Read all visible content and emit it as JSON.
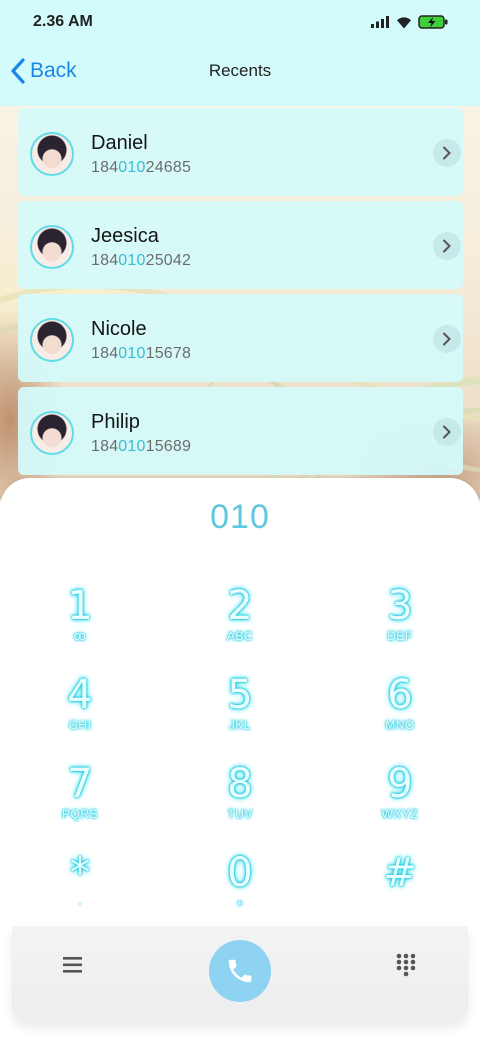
{
  "status_bar": {
    "time": "2.36 AM",
    "icons": [
      "signal-icon",
      "wifi-icon",
      "battery-charging-icon"
    ]
  },
  "header": {
    "back_label": "Back",
    "title": "Recents"
  },
  "contacts": [
    {
      "name": "Daniel",
      "number_pre": "184",
      "number_match": "010",
      "number_post": "24685"
    },
    {
      "name": "Jeesica",
      "number_pre": "184",
      "number_match": "010",
      "number_post": "25042"
    },
    {
      "name": "Nicole",
      "number_pre": "184",
      "number_match": "010",
      "number_post": "15678"
    },
    {
      "name": "Philip",
      "number_pre": "184",
      "number_match": "010",
      "number_post": "15689"
    }
  ],
  "dialpad": {
    "entered": "010",
    "keys": [
      {
        "digit": "1",
        "letters": "ꝏ"
      },
      {
        "digit": "2",
        "letters": "ABC"
      },
      {
        "digit": "3",
        "letters": "DEF"
      },
      {
        "digit": "4",
        "letters": "GHI"
      },
      {
        "digit": "5",
        "letters": "JKL"
      },
      {
        "digit": "6",
        "letters": "MNO"
      },
      {
        "digit": "7",
        "letters": "PQRS"
      },
      {
        "digit": "8",
        "letters": "TUV"
      },
      {
        "digit": "9",
        "letters": "WXYZ"
      },
      {
        "digit": "*",
        "letters": "·"
      },
      {
        "digit": "0",
        "letters": "+"
      },
      {
        "digit": "#",
        "letters": ""
      }
    ]
  },
  "bottom_bar": {
    "icons": [
      "menu-icon",
      "phone-icon",
      "keypad-icon"
    ]
  },
  "colors": {
    "header_bg": "#d4fbfb",
    "back_accent": "#1a86e8",
    "match_highlight": "#3bbbd4",
    "key_glow": "#17c7de",
    "call_button": "#8fd3f3"
  }
}
